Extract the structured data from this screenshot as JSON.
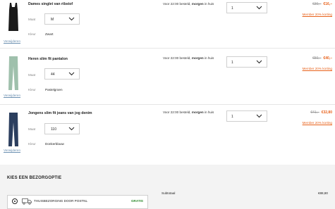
{
  "items": [
    {
      "name": "Dames singlet van ribstof",
      "size_label": "Maat",
      "size_value": "M",
      "color_label": "Kleur",
      "color_value": "Zwart",
      "delivery_prefix": "Voor 22:00 besteld,",
      "delivery_bold": "morgen",
      "delivery_suffix": "in huis",
      "quantity": "1",
      "old_price": "€30,–",
      "new_price": "€16,–",
      "member_link": "Member 20% korting",
      "remove_link": "Verwijderen",
      "garment_color": "#1a1a1a"
    },
    {
      "name": "Heren slim fit pantalon",
      "size_label": "Maat",
      "size_value": "44",
      "color_label": "Kleur",
      "color_value": "Pastelgroen",
      "delivery_prefix": "Voor 22:00 besteld,",
      "delivery_bold": "morgen",
      "delivery_suffix": "in huis",
      "quantity": "1",
      "old_price": "€50,–",
      "new_price": "€40,–",
      "member_link": "Member 20% korting",
      "remove_link": "Verwijderen",
      "garment_color": "#9fc0ac"
    },
    {
      "name": "Jongens slim fit jeans van jog denim",
      "size_label": "Maat",
      "size_value": "110",
      "color_label": "Kleur",
      "color_value": "Donkerblauw",
      "delivery_prefix": "Voor 22:00 besteld,",
      "delivery_bold": "morgen",
      "delivery_suffix": "in huis",
      "quantity": "1",
      "old_price": "€41,–",
      "new_price": "€32,80",
      "member_link": "Member 20% korting",
      "remove_link": "Verwijderen",
      "garment_color": "#2b3e5e"
    }
  ],
  "shipping": {
    "heading": "KIES EEN BEZORGOPTIE",
    "option_label": "THUISBEZORGING DOOR POSTNL",
    "option_price": "GRATIS"
  },
  "summary": {
    "subtotal_label": "Subtotaal",
    "subtotal_value": "€88,80"
  }
}
